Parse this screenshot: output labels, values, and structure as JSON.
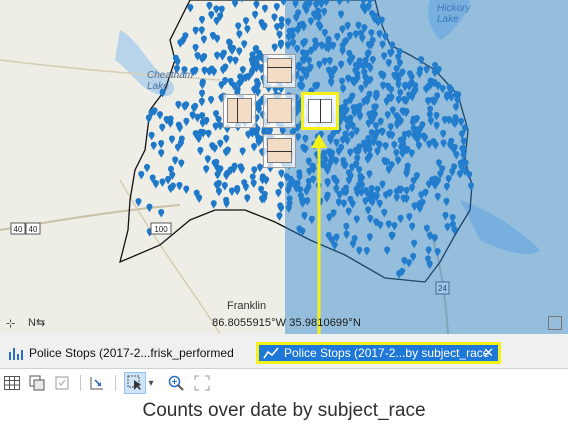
{
  "map": {
    "place_labels": {
      "cheatham_lake": "Cheatham\nLake",
      "hickory_lake": "Hickory\nLake",
      "franklin": "Franklin"
    },
    "route_shields": [
      "40",
      "40",
      "100",
      "24"
    ],
    "coordinates": "86.8055915°W 35.9810699°N",
    "point_color": "#1f78c8",
    "dock_overlay_color": "#2882d2"
  },
  "tabs": [
    {
      "label": "Police Stops (2017-2...frisk_performed",
      "icon": "bar-chart-icon",
      "active": false
    },
    {
      "label": "Police Stops (2017-2...by subject_race",
      "icon": "line-chart-icon",
      "active": true,
      "close_icon": "close-icon"
    }
  ],
  "toolbar": {
    "icons": [
      "table-icon",
      "switch-selection-icon",
      "filter-icon",
      "export-icon",
      "select-icon",
      "dropdown-icon",
      "zoom-in-icon",
      "full-extent-icon"
    ]
  },
  "chart": {
    "title": "Counts over date by subject_race"
  },
  "accent": {
    "highlight": "#f5f018",
    "tab_active": "#1e78d8"
  }
}
